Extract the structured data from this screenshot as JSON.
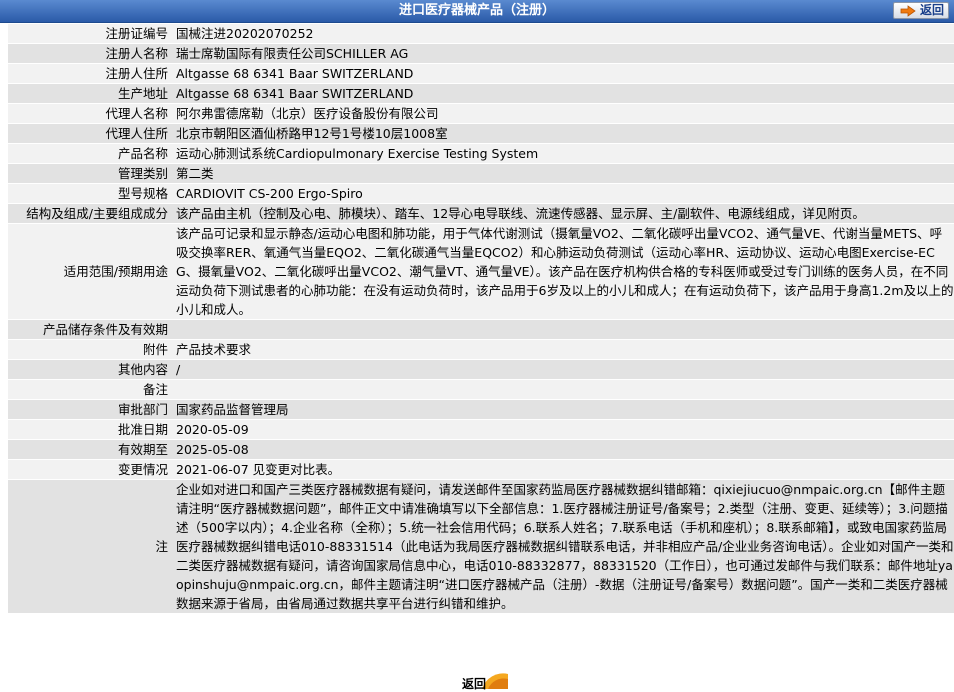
{
  "header": {
    "title": "进口医疗器械产品（注册）",
    "back_label": "返回"
  },
  "rows": [
    {
      "label": "注册证编号",
      "value": "国械注进20202070252"
    },
    {
      "label": "注册人名称",
      "value": "瑞士席勒国际有限责任公司SCHILLER AG"
    },
    {
      "label": "注册人住所",
      "value": "Altgasse 68 6341 Baar SWITZERLAND"
    },
    {
      "label": "生产地址",
      "value": "Altgasse 68 6341 Baar SWITZERLAND"
    },
    {
      "label": "代理人名称",
      "value": "阿尔弗雷德席勒（北京）医疗设备股份有限公司"
    },
    {
      "label": "代理人住所",
      "value": "北京市朝阳区酒仙桥路甲12号1号楼10层1008室"
    },
    {
      "label": "产品名称",
      "value": "运动心肺测试系统Cardiopulmonary Exercise Testing System"
    },
    {
      "label": "管理类别",
      "value": "第二类"
    },
    {
      "label": "型号规格",
      "value": "CARDIOVIT CS-200 Ergo-Spiro"
    },
    {
      "label": "结构及组成/主要组成成分",
      "value": "该产品由主机（控制及心电、肺模块）、踏车、12导心电导联线、流速传感器、显示屏、主/副软件、电源线组成，详见附页。"
    },
    {
      "label": "适用范围/预期用途",
      "value": "该产品可记录和显示静态/运动心电图和肺功能，用于气体代谢测试（摄氧量VO2、二氧化碳呼出量VCO2、通气量VE、代谢当量METS、呼吸交换率RER、氧通气当量EQO2、二氧化碳通气当量EQCO2）和心肺运动负荷测试（运动心率HR、运动协议、运动心电图Exercise-ECG、摄氧量VO2、二氧化碳呼出量VCO2、潮气量VT、通气量VE）。该产品在医疗机构供合格的专科医师或受过专门训练的医务人员，在不同运动负荷下测试患者的心肺功能：在没有运动负荷时，该产品用于6岁及以上的小儿和成人；在有运动负荷下，该产品用于身高1.2m及以上的小儿和成人。"
    },
    {
      "label": "产品储存条件及有效期",
      "value": ""
    },
    {
      "label": "附件",
      "value": "产品技术要求"
    },
    {
      "label": "其他内容",
      "value": "/"
    },
    {
      "label": "备注",
      "value": ""
    },
    {
      "label": "审批部门",
      "value": "国家药品监督管理局"
    },
    {
      "label": "批准日期",
      "value": "2020-05-09"
    },
    {
      "label": "有效期至",
      "value": "2025-05-08"
    },
    {
      "label": "变更情况",
      "value": "2021-06-07 见变更对比表。"
    },
    {
      "label": "注",
      "value": "企业如对进口和国产三类医疗器械数据有疑问，请发送邮件至国家药监局医疗器械数据纠错邮箱：qixiejiucuo@nmpaic.org.cn【邮件主题请注明“医疗器械数据问题”，邮件正文中请准确填写以下全部信息：1.医疗器械注册证号/备案号；2.类型（注册、变更、延续等）；3.问题描述（500字以内）；4.企业名称（全称）；5.统一社会信用代码；6.联系人姓名；7.联系电话（手机和座机）；8.联系邮箱】，或致电国家药监局医疗器械数据纠错电话010-88331514（此电话为我局医疗器械数据纠错联系电话，并非相应产品/企业业务咨询电话）。企业如对国产一类和二类医疗器械数据有疑问，请咨询国家局信息中心，电话010-88332877，88331520（工作日），也可通过发邮件与我们联系：邮件地址yaopinshuju@nmpaic.org.cn，邮件主题请注明“进口医疗器械产品（注册）-数据（注册证号/备案号）数据问题”。国产一类和二类医疗器械数据来源于省局，由省局通过数据共享平台进行纠错和维护。"
    }
  ],
  "footer": {
    "back_label": "返回"
  }
}
